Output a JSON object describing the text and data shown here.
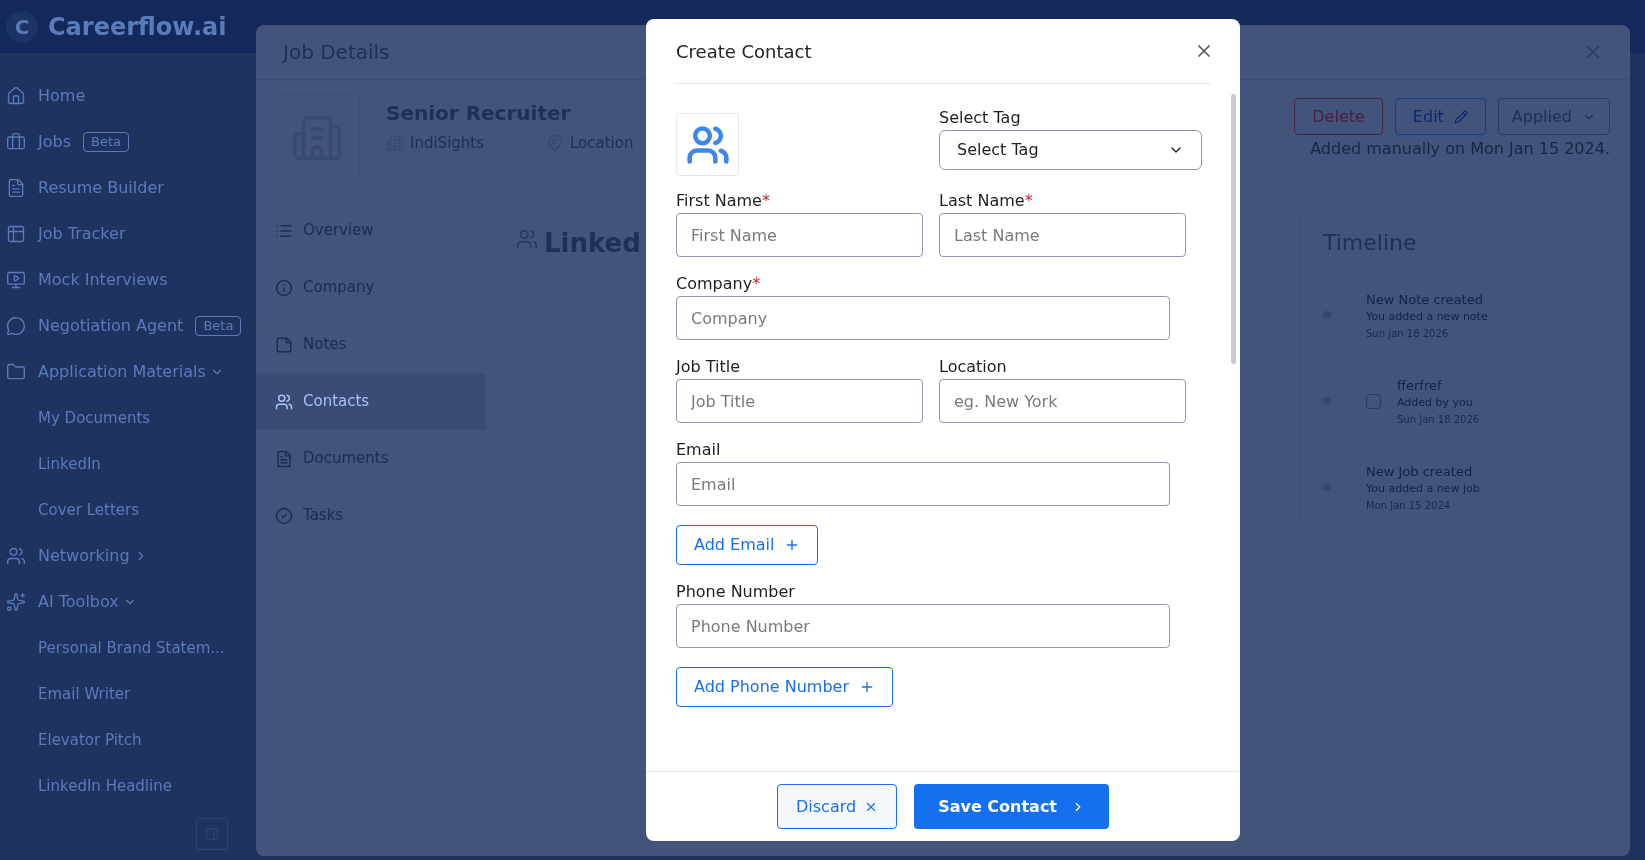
{
  "app": {
    "logo_letter": "C",
    "brand": "Careerflow.ai"
  },
  "sidebar": {
    "items": [
      {
        "label": "Home"
      },
      {
        "label": "Jobs",
        "badge": "Beta"
      },
      {
        "label": "Resume Builder"
      },
      {
        "label": "Job Tracker"
      },
      {
        "label": "Mock Interviews"
      },
      {
        "label": "Negotiation Agent",
        "badge": "Beta"
      },
      {
        "label": "Application Materials",
        "expanded": true,
        "children": [
          {
            "label": "My Documents"
          },
          {
            "label": "LinkedIn"
          },
          {
            "label": "Cover Letters"
          }
        ]
      },
      {
        "label": "Networking",
        "expanded": false
      },
      {
        "label": "AI Toolbox",
        "expanded": true,
        "children": [
          {
            "label": "Personal Brand Statem..."
          },
          {
            "label": "Email Writer"
          },
          {
            "label": "Elevator Pitch"
          },
          {
            "label": "LinkedIn Headline"
          }
        ]
      }
    ]
  },
  "job_details": {
    "title": "Job Details",
    "job_title": "Senior Recruiter",
    "company": "IndiSights",
    "location": "Location",
    "tabs": [
      {
        "label": "Overview",
        "selected": false
      },
      {
        "label": "Company",
        "selected": false
      },
      {
        "label": "Notes",
        "selected": false
      },
      {
        "label": "Contacts",
        "selected": true
      },
      {
        "label": "Documents",
        "selected": false
      },
      {
        "label": "Tasks",
        "selected": false
      }
    ],
    "section_heading": "Linked",
    "actions": {
      "delete": "Delete",
      "edit": "Edit",
      "status": "Applied"
    },
    "added_note": "Added manually on Mon Jan 15 2024.",
    "timeline": {
      "title": "Timeline",
      "entries": [
        {
          "kind": "event",
          "title": "New Note created",
          "subtitle": "You added a new note",
          "date": "Sun Jan 18 2026"
        },
        {
          "kind": "task",
          "title": "fferfref",
          "subtitle": "Added by you",
          "date": "Sun Jan 18 2026",
          "checked": false
        },
        {
          "kind": "event",
          "title": "New Job created",
          "subtitle": "You added a new job",
          "date": "Mon Jan 15 2024"
        }
      ]
    }
  },
  "modal": {
    "title": "Create Contact",
    "tag": {
      "label": "Select Tag",
      "placeholder": "Select Tag"
    },
    "rows": [
      [
        {
          "label": "First Name",
          "placeholder": "First Name",
          "required_mark": "*"
        },
        {
          "label": "Last Name",
          "placeholder": "Last Name",
          "required_mark": "*"
        }
      ],
      [
        {
          "label": "Company",
          "placeholder": "Company",
          "required_mark": "*"
        }
      ],
      [
        {
          "label": "Job Title",
          "placeholder": "Job Title"
        },
        {
          "label": "Location",
          "placeholder": "eg. New York"
        }
      ],
      [
        {
          "label": "Email",
          "placeholder": "Email",
          "add_button": "Add Email"
        }
      ],
      [
        {
          "label": "Phone Number",
          "placeholder": "Phone Number",
          "add_button": "Add Phone Number"
        }
      ]
    ],
    "discard": "Discard",
    "save": "Save Contact"
  }
}
